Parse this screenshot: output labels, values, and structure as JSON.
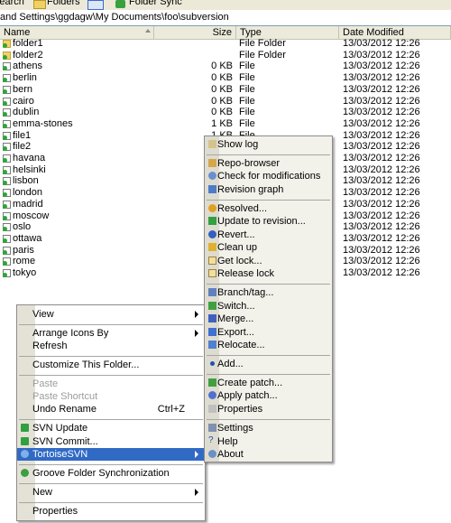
{
  "toolbar": {
    "search_label": "Search",
    "folders_label": "Folders",
    "folder_sync_label": "Folder Sync"
  },
  "address": {
    "path": "and Settings\\ggdagw\\My Documents\\foo\\subversion"
  },
  "columns": {
    "name": "Name",
    "size": "Size",
    "type": "Type",
    "date": "Date Modified"
  },
  "files": [
    {
      "name": "folder1",
      "size": "",
      "type": "File Folder",
      "date": "13/03/2012 12:26",
      "kind": "folder"
    },
    {
      "name": "folder2",
      "size": "",
      "type": "File Folder",
      "date": "13/03/2012 12:26",
      "kind": "folder"
    },
    {
      "name": "athens",
      "size": "0 KB",
      "type": "File",
      "date": "13/03/2012 12:26",
      "kind": "file"
    },
    {
      "name": "berlin",
      "size": "0 KB",
      "type": "File",
      "date": "13/03/2012 12:26",
      "kind": "file"
    },
    {
      "name": "bern",
      "size": "0 KB",
      "type": "File",
      "date": "13/03/2012 12:26",
      "kind": "file"
    },
    {
      "name": "cairo",
      "size": "0 KB",
      "type": "File",
      "date": "13/03/2012 12:26",
      "kind": "file"
    },
    {
      "name": "dublin",
      "size": "0 KB",
      "type": "File",
      "date": "13/03/2012 12:26",
      "kind": "file"
    },
    {
      "name": "emma-stones",
      "size": "1 KB",
      "type": "File",
      "date": "13/03/2012 12:26",
      "kind": "file"
    },
    {
      "name": "file1",
      "size": "1 KB",
      "type": "File",
      "date": "13/03/2012 12:26",
      "kind": "file"
    },
    {
      "name": "file2",
      "size": "",
      "type": "",
      "date": "13/03/2012 12:26",
      "kind": "file"
    },
    {
      "name": "havana",
      "size": "",
      "type": "",
      "date": "13/03/2012 12:26",
      "kind": "file"
    },
    {
      "name": "helsinki",
      "size": "",
      "type": "",
      "date": "13/03/2012 12:26",
      "kind": "file"
    },
    {
      "name": "lisbon",
      "size": "",
      "type": "",
      "date": "13/03/2012 12:26",
      "kind": "file"
    },
    {
      "name": "london",
      "size": "",
      "type": "",
      "date": "13/03/2012 12:26",
      "kind": "file"
    },
    {
      "name": "madrid",
      "size": "",
      "type": "",
      "date": "13/03/2012 12:26",
      "kind": "file"
    },
    {
      "name": "moscow",
      "size": "",
      "type": "",
      "date": "13/03/2012 12:26",
      "kind": "file"
    },
    {
      "name": "oslo",
      "size": "",
      "type": "",
      "date": "13/03/2012 12:26",
      "kind": "file"
    },
    {
      "name": "ottawa",
      "size": "",
      "type": "",
      "date": "13/03/2012 12:26",
      "kind": "file"
    },
    {
      "name": "paris",
      "size": "",
      "type": "",
      "date": "13/03/2012 12:26",
      "kind": "file"
    },
    {
      "name": "rome",
      "size": "",
      "type": "",
      "date": "13/03/2012 12:26",
      "kind": "file"
    },
    {
      "name": "tokyo",
      "size": "",
      "type": "",
      "date": "13/03/2012 12:26",
      "kind": "file"
    }
  ],
  "context_menu": {
    "view": "View",
    "arrange": "Arrange Icons By",
    "refresh": "Refresh",
    "customize": "Customize This Folder...",
    "paste": "Paste",
    "paste_shortcut": "Paste Shortcut",
    "undo_rename": "Undo Rename",
    "undo_shortcut": "Ctrl+Z",
    "svn_update": "SVN Update",
    "svn_commit": "SVN Commit...",
    "tortoise": "TortoiseSVN",
    "groove": "Groove Folder Synchronization",
    "new": "New",
    "properties": "Properties"
  },
  "svn_menu": {
    "show_log": "Show log",
    "repo_browser": "Repo-browser",
    "check_mods": "Check for modifications",
    "revision_graph": "Revision graph",
    "resolved": "Resolved...",
    "update_to_rev": "Update to revision...",
    "revert": "Revert...",
    "clean_up": "Clean up",
    "get_lock": "Get lock...",
    "release_lock": "Release lock",
    "branch_tag": "Branch/tag...",
    "switch": "Switch...",
    "merge": "Merge...",
    "export": "Export...",
    "relocate": "Relocate...",
    "add": "Add...",
    "create_patch": "Create patch...",
    "apply_patch": "Apply patch...",
    "properties": "Properties",
    "settings": "Settings",
    "help": "Help",
    "about": "About"
  }
}
